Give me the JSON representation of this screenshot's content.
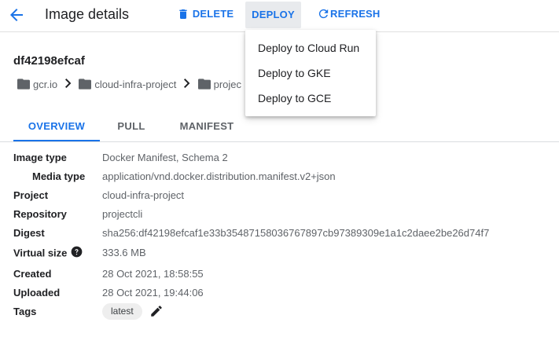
{
  "header": {
    "title": "Image details",
    "delete_label": "DELETE",
    "deploy_label": "DEPLOY",
    "refresh_label": "REFRESH"
  },
  "deploy_menu": {
    "items": [
      "Deploy to Cloud Run",
      "Deploy to GKE",
      "Deploy to GCE"
    ]
  },
  "image": {
    "name": "df42198efcaf"
  },
  "breadcrumb": [
    "gcr.io",
    "cloud-infra-project",
    "projec"
  ],
  "tabs": [
    "OVERVIEW",
    "PULL",
    "MANIFEST"
  ],
  "details": {
    "image_type": {
      "label": "Image type",
      "value": "Docker Manifest, Schema 2"
    },
    "media_type": {
      "label": "Media type",
      "value": "application/vnd.docker.distribution.manifest.v2+json"
    },
    "project": {
      "label": "Project",
      "value": "cloud-infra-project"
    },
    "repository": {
      "label": "Repository",
      "value": "projectcli"
    },
    "digest": {
      "label": "Digest",
      "value": "sha256:df42198efcaf1e33b35487158036767897cb97389309e1a1c2daee2be26d74f7"
    },
    "virtual_size": {
      "label": "Virtual size",
      "value": "333.6 MB"
    },
    "created": {
      "label": "Created",
      "value": "28 Oct 2021, 18:58:55"
    },
    "uploaded": {
      "label": "Uploaded",
      "value": "28 Oct 2021, 19:44:06"
    },
    "tags": {
      "label": "Tags",
      "values": [
        "latest"
      ]
    }
  },
  "colors": {
    "accent": "#1a73e8",
    "text": "#202124",
    "muted": "#5f6368"
  },
  "icons": [
    "arrow-back-icon",
    "trash-icon",
    "refresh-icon",
    "folder-icon",
    "chevron-right-icon",
    "help-icon",
    "pencil-icon"
  ]
}
